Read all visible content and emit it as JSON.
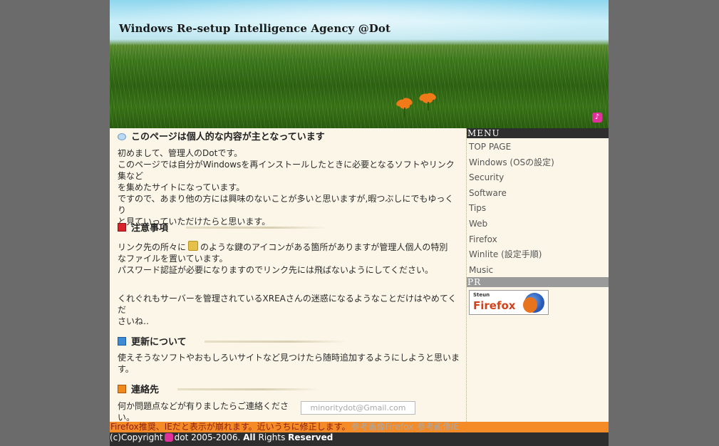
{
  "header": {
    "site_title": "Windows Re-setup Intelligence Agency @Dot"
  },
  "sections": [
    {
      "title": "このページは個人的な内容が主となっています",
      "icon": "speech-bubble-icon",
      "lines": [
        "初めまして、管理人のDotです。",
        "このページでは自分がWindowsを再インストールしたときに必要となるソフトやリンク集など",
        "を集めたサイトになっています。",
        "ですので、あまり他の方には興味のないことが多いと思いますが,暇つぶしにでもゆっくり",
        "と見ていっていただけたらと思います。"
      ]
    },
    {
      "title": "注意事項",
      "icon": "red-flag-icon",
      "line1_a": "リンク先の所々に",
      "line1_b": "のような鍵のアイコンがある箇所がありますが管理人個人の特別",
      "line2": "なファイルを置いています。",
      "line3": "パスワード認証が必要になりますのでリンク先には飛ばないようにしてください。",
      "line4": "くれぐれもサーバーを管理されているXREAさんの迷惑になるようなことだけはやめてくだ",
      "line5": "さいね‥"
    },
    {
      "title": "更新について",
      "icon": "blue-flag-icon",
      "text": "使えそうなソフトやおもしろいサイトなど見つけたら随時追加するようにしようと思います。"
    },
    {
      "title": "連絡先",
      "icon": "orange-flag-icon",
      "text": "何か問題点などが有りましたらご連絡ください。",
      "email_image_text": "minoritydot@Gmail.com"
    }
  ],
  "sidebar": {
    "menu_heading": "MENU",
    "menu_items": [
      "TOP PAGE",
      "Windows (OSの設定)",
      "Security",
      "Software",
      "Tips",
      "Web",
      "Firefox",
      "Winlite (設定手順)",
      "Music"
    ],
    "pr_heading": "PR",
    "pr_banner": {
      "line1": "Steun",
      "line2": "Firefox"
    }
  },
  "footer": {
    "note": "Firefox推奨、IEだと表示が崩れます。近いうちに修正します。",
    "link1": "参考画像Firefox",
    "link2": "参考画像IE",
    "copyright_prefix": "(c)Copyright",
    "copyright_name": "dot 2005-2006.",
    "copyright_all": "All",
    "copyright_rights": "Rights",
    "copyright_reserved": "Reserved"
  },
  "colors": {
    "page_bg": "#6b6b6b",
    "content_bg": "#fbf6e8",
    "menu_heading_bg": "#2e2e2e",
    "pr_heading_bg": "#9a9a9a",
    "footer_note_bg": "#f58b26",
    "copyright_bg": "#2e2e2e",
    "accent_pink": "#e0319a"
  }
}
